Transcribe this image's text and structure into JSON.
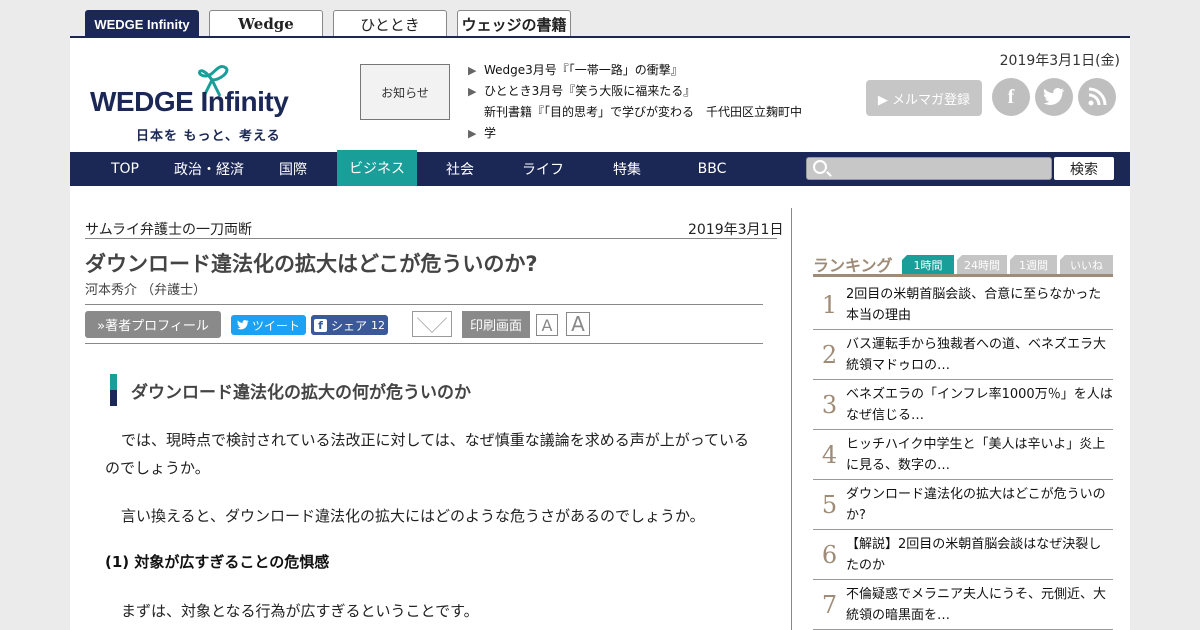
{
  "site_tabs": [
    "WEDGE Infinity",
    "Wedge",
    "ひととき",
    "ウェッジの書籍"
  ],
  "header": {
    "logo_main": "WEDGE Infinity",
    "logo_sub": "日本を もっと、考える",
    "notice_label": "お知らせ",
    "notices": [
      "Wedge3月号『「一帯一路」の衝撃』",
      "ひととき3月号『笑う大阪に福来たる』",
      "新刊書籍『「目的思考」で学びが変わる　千代田区立麹町中学\n校校長・工藤勇一の挑戦』"
    ],
    "date": "2019年3月1日(金)",
    "mail_button": "▶ メルマガ登録",
    "social": [
      "facebook-icon",
      "twitter-icon",
      "rss-icon"
    ]
  },
  "nav": {
    "items": [
      "TOP",
      "政治・経済",
      "国際",
      "ビジネス",
      "社会",
      "ライフ",
      "特集",
      "BBC"
    ],
    "active": "ビジネス",
    "search_button": "検索"
  },
  "article": {
    "series": "サムライ弁護士の一刀両断",
    "date": "2019年3月1日",
    "title": "ダウンロード違法化の拡大はどこが危ういのか?",
    "author": "河本秀介 （弁護士）",
    "profile_button": "»著者プロフィール",
    "tweet_button": "ツイート",
    "share_button": "シェア",
    "share_count": "12",
    "print_button": "印刷画面",
    "font_small": "A",
    "font_large": "A",
    "heading": "ダウンロード違法化の拡大の何が危ういのか",
    "paragraphs": [
      "では、現時点で検討されている法改正に対しては、なぜ慎重な議論を求める声が上がっているのでしょうか。",
      "言い換えると、ダウンロード違法化の拡大にはどのような危うさがあるのでしょうか。"
    ],
    "subheading": "(1) 対象が広すぎることの危惧感",
    "paragraph_last": "まずは、対象となる行為が広すぎるということです。"
  },
  "ranking": {
    "title": "ランキング",
    "tabs": [
      "1時間",
      "24時間",
      "1週間",
      "いいね"
    ],
    "active_tab": "1時間",
    "items": [
      {
        "num": "1",
        "text": "2回目の米朝首脳会談、合意に至らなかった本当の理由"
      },
      {
        "num": "2",
        "text": "バス運転手から独裁者への道、ベネズエラ大統領マドゥロの…"
      },
      {
        "num": "3",
        "text": "ベネズエラの「インフレ率1000万％」を人はなぜ信じる…"
      },
      {
        "num": "4",
        "text": "ヒッチハイク中学生と「美人は辛いよ」炎上に見る、数字の…"
      },
      {
        "num": "5",
        "text": "ダウンロード違法化の拡大はどこが危ういのか?"
      },
      {
        "num": "6",
        "text": "【解説】2回目の米朝首脳会談はなぜ決裂したのか"
      },
      {
        "num": "7",
        "text": "不倫疑惑でメラニア夫人にうそ、元側近、大統領の暗黒面を…"
      }
    ]
  },
  "colors": {
    "navy": "#1b2856",
    "teal": "#1a9e9a",
    "gold": "#9e8c78"
  }
}
